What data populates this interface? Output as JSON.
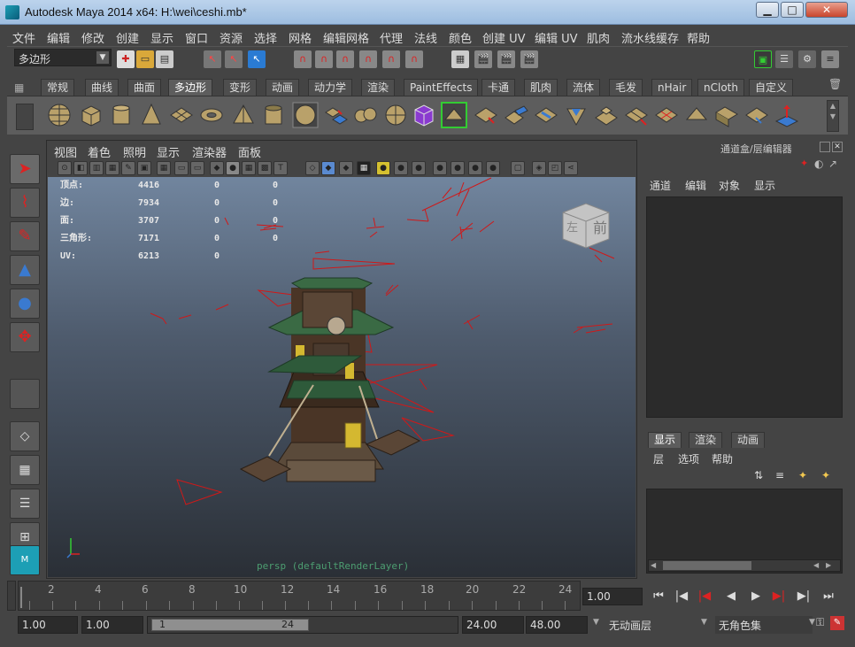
{
  "window": {
    "title": "Autodesk Maya 2014 x64: H:\\wei\\ceshi.mb*",
    "minimize": "▁",
    "maximize": "□",
    "close": "✕"
  },
  "menubar": [
    "文件",
    "编辑",
    "修改",
    "创建",
    "显示",
    "窗口",
    "资源",
    "选择",
    "网格",
    "编辑网格",
    "代理",
    "法线",
    "颜色",
    "创建 UV",
    "编辑 UV",
    "肌肉",
    "流水线缓存",
    "帮助"
  ],
  "statusline": {
    "mode": "多边形"
  },
  "shelf": {
    "tabs": [
      "常规",
      "曲线",
      "曲面",
      "多边形",
      "变形",
      "动画",
      "动力学",
      "渲染",
      "PaintEffects",
      "卡通",
      "肌肉",
      "流体",
      "毛发",
      "nHair",
      "nCloth",
      "自定义"
    ],
    "active_tab": "多边形"
  },
  "viewport": {
    "menu": [
      "视图",
      "着色",
      "照明",
      "显示",
      "渲染器",
      "面板"
    ],
    "camera_label": "persp (defaultRenderLayer)",
    "viewcube": {
      "left": "左",
      "front": "前"
    },
    "hud": {
      "labels": [
        "顶点:",
        "边:",
        "面:",
        "三角形:",
        "UV:"
      ],
      "col1": [
        "4416",
        "7934",
        "3707",
        "7171",
        "6213"
      ],
      "col2": [
        "0",
        "0",
        "0",
        "0",
        "0"
      ],
      "col3": [
        "0",
        "0",
        "0",
        "0",
        ""
      ]
    }
  },
  "channelbox": {
    "header": "通道盒/层编辑器",
    "menu": [
      "通道",
      "编辑",
      "对象",
      "显示"
    ]
  },
  "layereditor": {
    "tabs": [
      "显示",
      "渲染",
      "动画"
    ],
    "active_tab": "显示",
    "menu": [
      "层",
      "选项",
      "帮助"
    ]
  },
  "timeslider": {
    "ticks": [
      "2",
      "4",
      "6",
      "8",
      "10",
      "12",
      "14",
      "16",
      "18",
      "20",
      "22",
      "24"
    ],
    "current_frame": "1.00"
  },
  "rangeslider": {
    "start_time": "1.00",
    "playback_start": "1.00",
    "range_start": "1",
    "range_end": "24",
    "playback_end": "24.00",
    "end_time": "48.00",
    "anim_layer": "无动画层",
    "char_set": "无角色集"
  }
}
